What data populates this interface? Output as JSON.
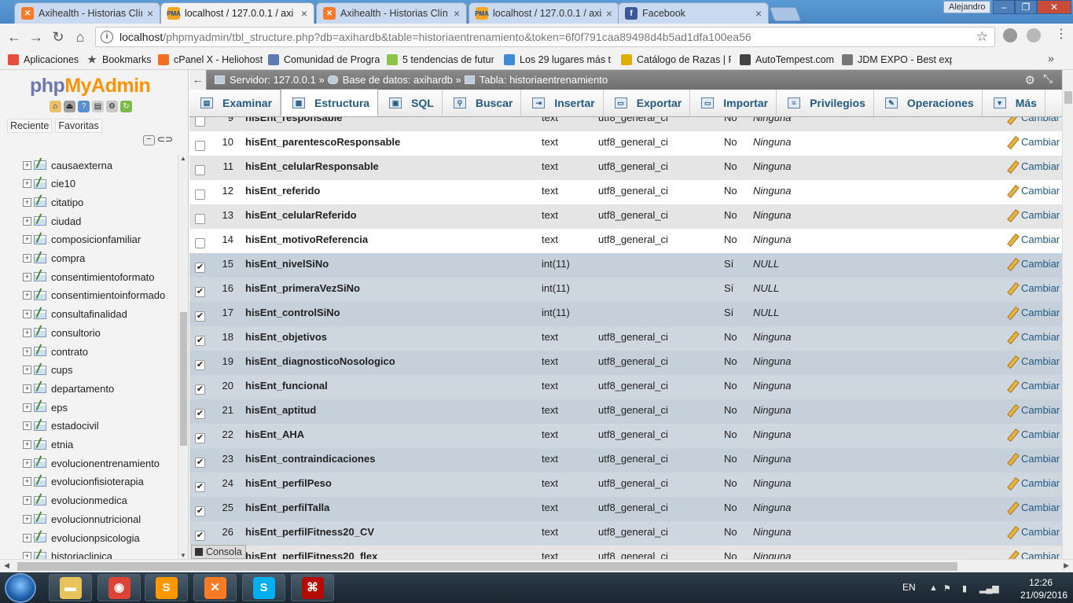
{
  "browser": {
    "tabs": [
      {
        "title": "Axihealth - Historias Clín",
        "icon": "xampp-icon",
        "active": false
      },
      {
        "title": "localhost / 127.0.0.1 / axi",
        "icon": "phpmyadmin-icon",
        "active": true
      },
      {
        "title": "Axihealth - Historias Clín",
        "icon": "xampp-icon",
        "active": false
      },
      {
        "title": "localhost / 127.0.0.1 / axi",
        "icon": "phpmyadmin-icon",
        "active": false
      },
      {
        "title": "Facebook",
        "icon": "facebook-icon",
        "active": false
      }
    ],
    "user": "Alejandro",
    "url_host": "localhost",
    "url_path": "/phpmyadmin/tbl_structure.php?db=axihardb&table=historiaentrenamiento&token=6f0f791caa89498d4b5ad1dfa100ea56",
    "bookmarks": [
      {
        "label": "Aplicaciones",
        "icon": "apps-grid-icon",
        "color": "#e74c3c"
      },
      {
        "label": "Bookmarks",
        "icon": "star-icon",
        "color": "#555555"
      },
      {
        "label": "cPanel X - Heliohost",
        "icon": "cpanel-icon",
        "color": "#f37021"
      },
      {
        "label": "Comunidad de Progra",
        "icon": "code-icon",
        "color": "#5a7bb5"
      },
      {
        "label": "5 tendencias de futuro",
        "icon": "green-circle-icon",
        "color": "#8bc34a"
      },
      {
        "label": "Los 29 lugares más te",
        "icon": "globe-icon",
        "color": "#3f8bd8"
      },
      {
        "label": "Catálogo de Razas | P",
        "icon": "yellow-square-icon",
        "color": "#e0b000"
      },
      {
        "label": "AutoTempest.com",
        "icon": "search-globe-icon",
        "color": "#444444"
      },
      {
        "label": "JDM EXPO - Best expo",
        "icon": "page-icon",
        "color": "#777777"
      }
    ]
  },
  "pma": {
    "logo_php": "php",
    "logo_myadmin": "MyAdmin",
    "nav_tabs": [
      "Reciente",
      "Favoritas"
    ],
    "tables": [
      "causaexterna",
      "cie10",
      "citatipo",
      "ciudad",
      "composicionfamiliar",
      "compra",
      "consentimientoformato",
      "consentimientoinformado",
      "consultafinalidad",
      "consultorio",
      "contrato",
      "cups",
      "departamento",
      "eps",
      "estadocivil",
      "etnia",
      "evolucionentrenamiento",
      "evolucionfisioterapia",
      "evolucionmedica",
      "evolucionnutricional",
      "evolucionpsicologia",
      "historiaclinica"
    ],
    "breadcrumb": {
      "server": "Servidor: 127.0.0.1 »",
      "database": "Base de datos: axihardb »",
      "table": "Tabla: historiaentrenamiento"
    },
    "menu": [
      {
        "label": "Examinar",
        "icon": "browse-icon",
        "glyph": "▤"
      },
      {
        "label": "Estructura",
        "icon": "structure-icon",
        "glyph": "▦",
        "active": true
      },
      {
        "label": "SQL",
        "icon": "sql-icon",
        "glyph": "▣"
      },
      {
        "label": "Buscar",
        "icon": "search-icon",
        "glyph": "⚲"
      },
      {
        "label": "Insertar",
        "icon": "insert-icon",
        "glyph": "⇥"
      },
      {
        "label": "Exportar",
        "icon": "export-icon",
        "glyph": "▭"
      },
      {
        "label": "Importar",
        "icon": "import-icon",
        "glyph": "▭"
      },
      {
        "label": "Privilegios",
        "icon": "privileges-icon",
        "glyph": "≡"
      },
      {
        "label": "Operaciones",
        "icon": "wrench-icon",
        "glyph": "✎"
      },
      {
        "label": "Más",
        "icon": "chevron-down-icon",
        "glyph": "▼"
      }
    ],
    "action_label": "Cambiar",
    "console_label": "Consola",
    "fields": [
      {
        "num": "9",
        "name": "hisEnt_responsable",
        "type": "text",
        "collation": "utf8_general_ci",
        "null": "No",
        "default": "Ninguna",
        "checked": false
      },
      {
        "num": "10",
        "name": "hisEnt_parentescoResponsable",
        "type": "text",
        "collation": "utf8_general_ci",
        "null": "No",
        "default": "Ninguna",
        "checked": false
      },
      {
        "num": "11",
        "name": "hisEnt_celularResponsable",
        "type": "text",
        "collation": "utf8_general_ci",
        "null": "No",
        "default": "Ninguna",
        "checked": false
      },
      {
        "num": "12",
        "name": "hisEnt_referido",
        "type": "text",
        "collation": "utf8_general_ci",
        "null": "No",
        "default": "Ninguna",
        "checked": false
      },
      {
        "num": "13",
        "name": "hisEnt_celularReferido",
        "type": "text",
        "collation": "utf8_general_ci",
        "null": "No",
        "default": "Ninguna",
        "checked": false
      },
      {
        "num": "14",
        "name": "hisEnt_motivoReferencia",
        "type": "text",
        "collation": "utf8_general_ci",
        "null": "No",
        "default": "Ninguna",
        "checked": false
      },
      {
        "num": "15",
        "name": "hisEnt_nivelSiNo",
        "type": "int(11)",
        "collation": "",
        "null": "Sí",
        "default": "NULL",
        "checked": true
      },
      {
        "num": "16",
        "name": "hisEnt_primeraVezSiNo",
        "type": "int(11)",
        "collation": "",
        "null": "Sí",
        "default": "NULL",
        "checked": true
      },
      {
        "num": "17",
        "name": "hisEnt_controlSiNo",
        "type": "int(11)",
        "collation": "",
        "null": "Sí",
        "default": "NULL",
        "checked": true
      },
      {
        "num": "18",
        "name": "hisEnt_objetivos",
        "type": "text",
        "collation": "utf8_general_ci",
        "null": "No",
        "default": "Ninguna",
        "checked": true
      },
      {
        "num": "19",
        "name": "hisEnt_diagnosticoNosologico",
        "type": "text",
        "collation": "utf8_general_ci",
        "null": "No",
        "default": "Ninguna",
        "checked": true
      },
      {
        "num": "20",
        "name": "hisEnt_funcional",
        "type": "text",
        "collation": "utf8_general_ci",
        "null": "No",
        "default": "Ninguna",
        "checked": true
      },
      {
        "num": "21",
        "name": "hisEnt_aptitud",
        "type": "text",
        "collation": "utf8_general_ci",
        "null": "No",
        "default": "Ninguna",
        "checked": true
      },
      {
        "num": "22",
        "name": "hisEnt_AHA",
        "type": "text",
        "collation": "utf8_general_ci",
        "null": "No",
        "default": "Ninguna",
        "checked": true
      },
      {
        "num": "23",
        "name": "hisEnt_contraindicaciones",
        "type": "text",
        "collation": "utf8_general_ci",
        "null": "No",
        "default": "Ninguna",
        "checked": true
      },
      {
        "num": "24",
        "name": "hisEnt_perfilPeso",
        "type": "text",
        "collation": "utf8_general_ci",
        "null": "No",
        "default": "Ninguna",
        "checked": true
      },
      {
        "num": "25",
        "name": "hisEnt_perfilTalla",
        "type": "text",
        "collation": "utf8_general_ci",
        "null": "No",
        "default": "Ninguna",
        "checked": true
      },
      {
        "num": "26",
        "name": "hisEnt_perfilFitness20_CV",
        "type": "text",
        "collation": "utf8_general_ci",
        "null": "No",
        "default": "Ninguna",
        "checked": true
      },
      {
        "num": "27",
        "name": "hisEnt_perfilFitness20_flex",
        "type": "text",
        "collation": "utf8_general_ci",
        "null": "No",
        "default": "Ninguna",
        "checked": false
      }
    ]
  },
  "taskbar": {
    "apps": [
      {
        "name": "file-explorer",
        "glyph": "▬",
        "color": "#e8c25a"
      },
      {
        "name": "chrome",
        "glyph": "◉",
        "color": "#db4437"
      },
      {
        "name": "sublime-text",
        "glyph": "S",
        "color": "#ff9800"
      },
      {
        "name": "xampp",
        "glyph": "✕",
        "color": "#fb7a24"
      },
      {
        "name": "skype",
        "glyph": "S",
        "color": "#00aff0"
      },
      {
        "name": "acrobat",
        "glyph": "⌘",
        "color": "#b30b00"
      }
    ],
    "lang": "EN",
    "time": "12:26",
    "date": "21/09/2016"
  }
}
